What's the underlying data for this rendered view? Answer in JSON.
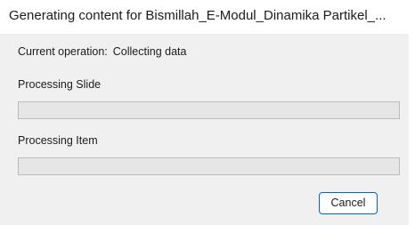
{
  "window": {
    "title": "Generating content for Bismillah_E-Modul_Dinamika Partikel_..."
  },
  "operation": {
    "label": "Current operation:",
    "value": "Collecting data"
  },
  "slide_progress": {
    "label": "Processing Slide",
    "percent": 0
  },
  "item_progress": {
    "label": "Processing Item",
    "percent": 0
  },
  "buttons": {
    "cancel_label": "Cancel"
  },
  "colors": {
    "accent": "#0067c0",
    "progress_fill": "#06b025",
    "progress_track": "#e6e6e6",
    "dialog_background": "#f0f0f0"
  }
}
